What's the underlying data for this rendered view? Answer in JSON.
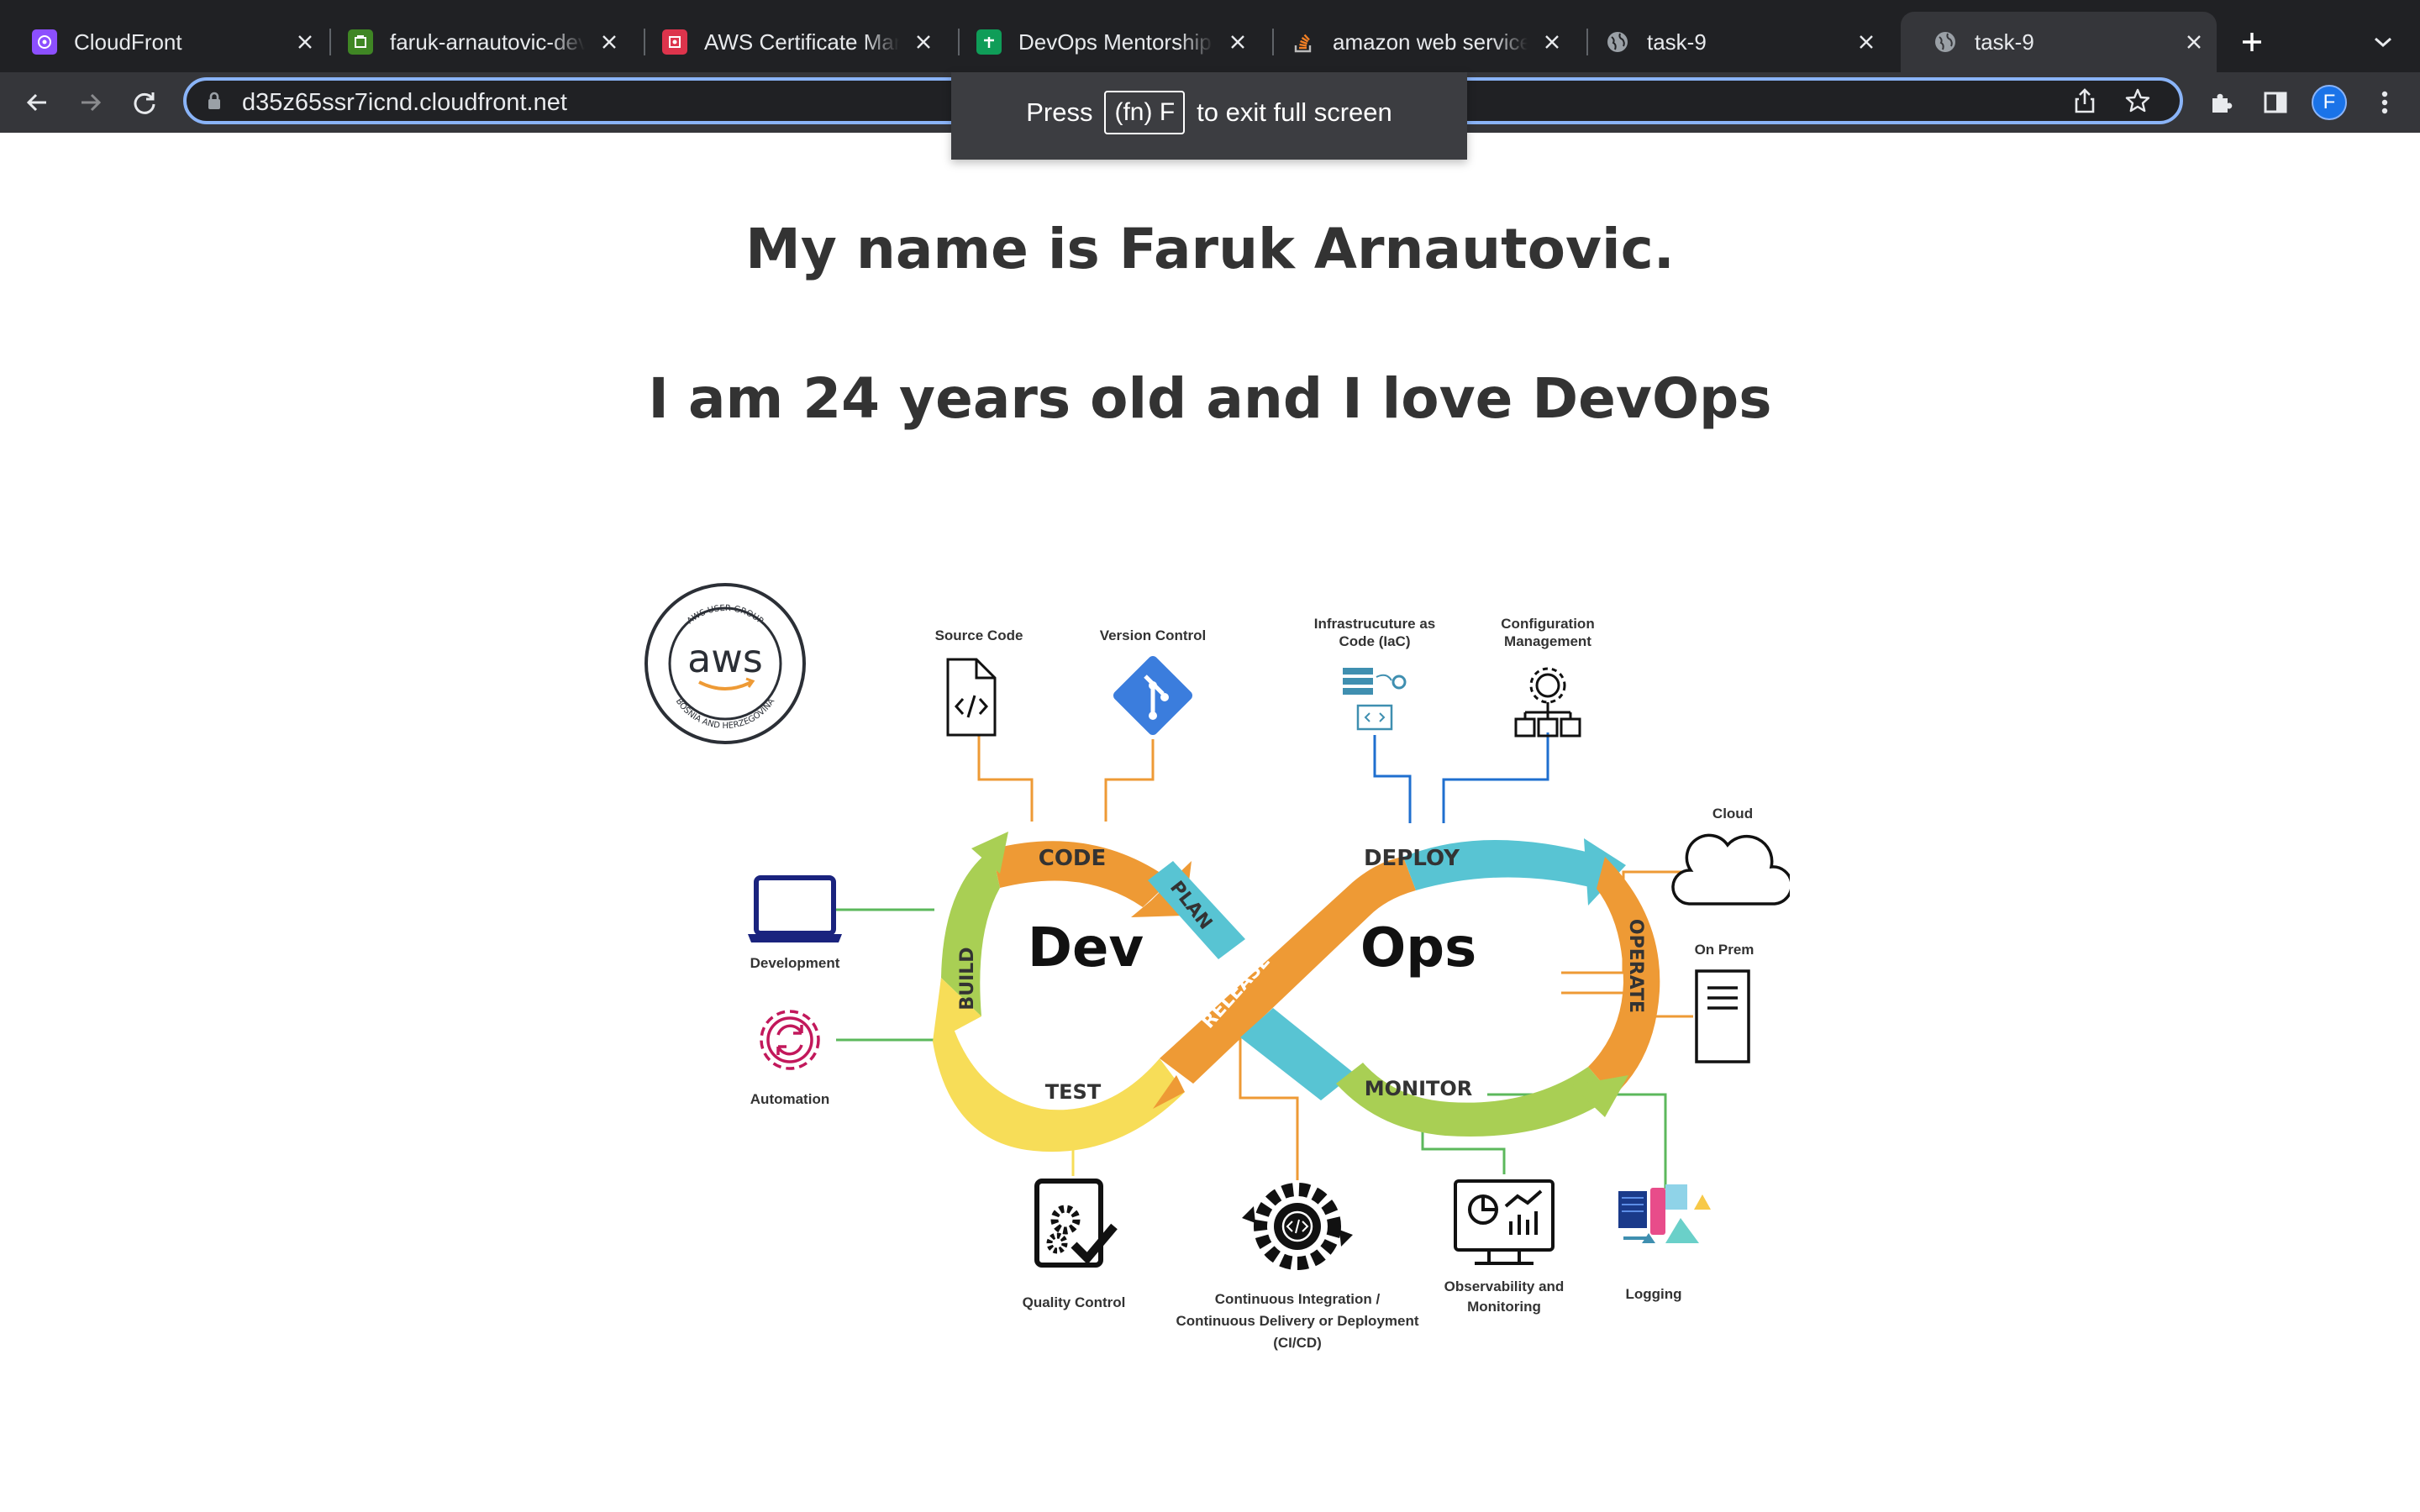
{
  "browser": {
    "tabs": [
      {
        "title": "CloudFront",
        "favicon": "cloudfront-icon",
        "color": "#8c4fff"
      },
      {
        "title": "faruk-arnautovic-devops",
        "favicon": "s3-bucket-icon",
        "color": "#3f8624"
      },
      {
        "title": "AWS Certificate Manager",
        "favicon": "certificate-manager-icon",
        "color": "#dd344c"
      },
      {
        "title": "DevOps Mentorship Program",
        "favicon": "google-sheets-icon",
        "color": "#0f9d58"
      },
      {
        "title": "amazon web services",
        "favicon": "stack-overflow-icon",
        "color": "#f48024"
      },
      {
        "title": "task-9",
        "favicon": "globe-icon",
        "color": "#9aa0a6"
      },
      {
        "title": "task-9",
        "favicon": "globe-icon",
        "color": "#9aa0a6",
        "active": true
      }
    ],
    "url": "d35z65ssr7icnd.cloudfront.net",
    "profile_initial": "F",
    "fullscreen_toast": {
      "prefix": "Press",
      "key": "(fn) F",
      "suffix": "to exit full screen"
    }
  },
  "page": {
    "heading1": "My name is Faruk Arnautovic.",
    "heading2": "I am 24 years old and I love DevOps"
  },
  "diagram": {
    "logo": {
      "text": "aws",
      "ring_top": "AWS USER GROUP",
      "ring_bottom": "BOSNIA AND HERZEGOVINA"
    },
    "dev_word": "Dev",
    "ops_word": "Ops",
    "stages": {
      "code": "CODE",
      "plan": "PLAN",
      "build": "BUILD",
      "test": "TEST",
      "release": "RELEASE",
      "deploy": "DEPLOY",
      "operate": "OPERATE",
      "monitor": "MONITOR"
    },
    "labels": {
      "source_code": "Source Code",
      "version_control": "Version Control",
      "iac_line1": "Infrastrucuture as",
      "iac_line2": "Code (IaC)",
      "config_line1": "Configuration",
      "config_line2": "Management",
      "cloud": "Cloud",
      "on_prem": "On Prem",
      "development": "Development",
      "automation": "Automation",
      "quality_control": "Quality Control",
      "cicd_line1": "Continuous Integration /",
      "cicd_line2": "Continuous Delivery or Deployment",
      "cicd_line3": "(CI/CD)",
      "observability_line1": "Observability and",
      "observability_line2": "Monitoring",
      "logging": "Logging"
    },
    "colors": {
      "orange": "#ee9a35",
      "teal": "#58c4d3",
      "green": "#a9cf54",
      "yellow": "#f7dd58",
      "blue_line": "#1f6fcf",
      "green_line": "#5cb85c",
      "git_blue": "#3b7ddd",
      "automation_pink": "#c2185b",
      "laptop_navy": "#1a237e"
    }
  }
}
